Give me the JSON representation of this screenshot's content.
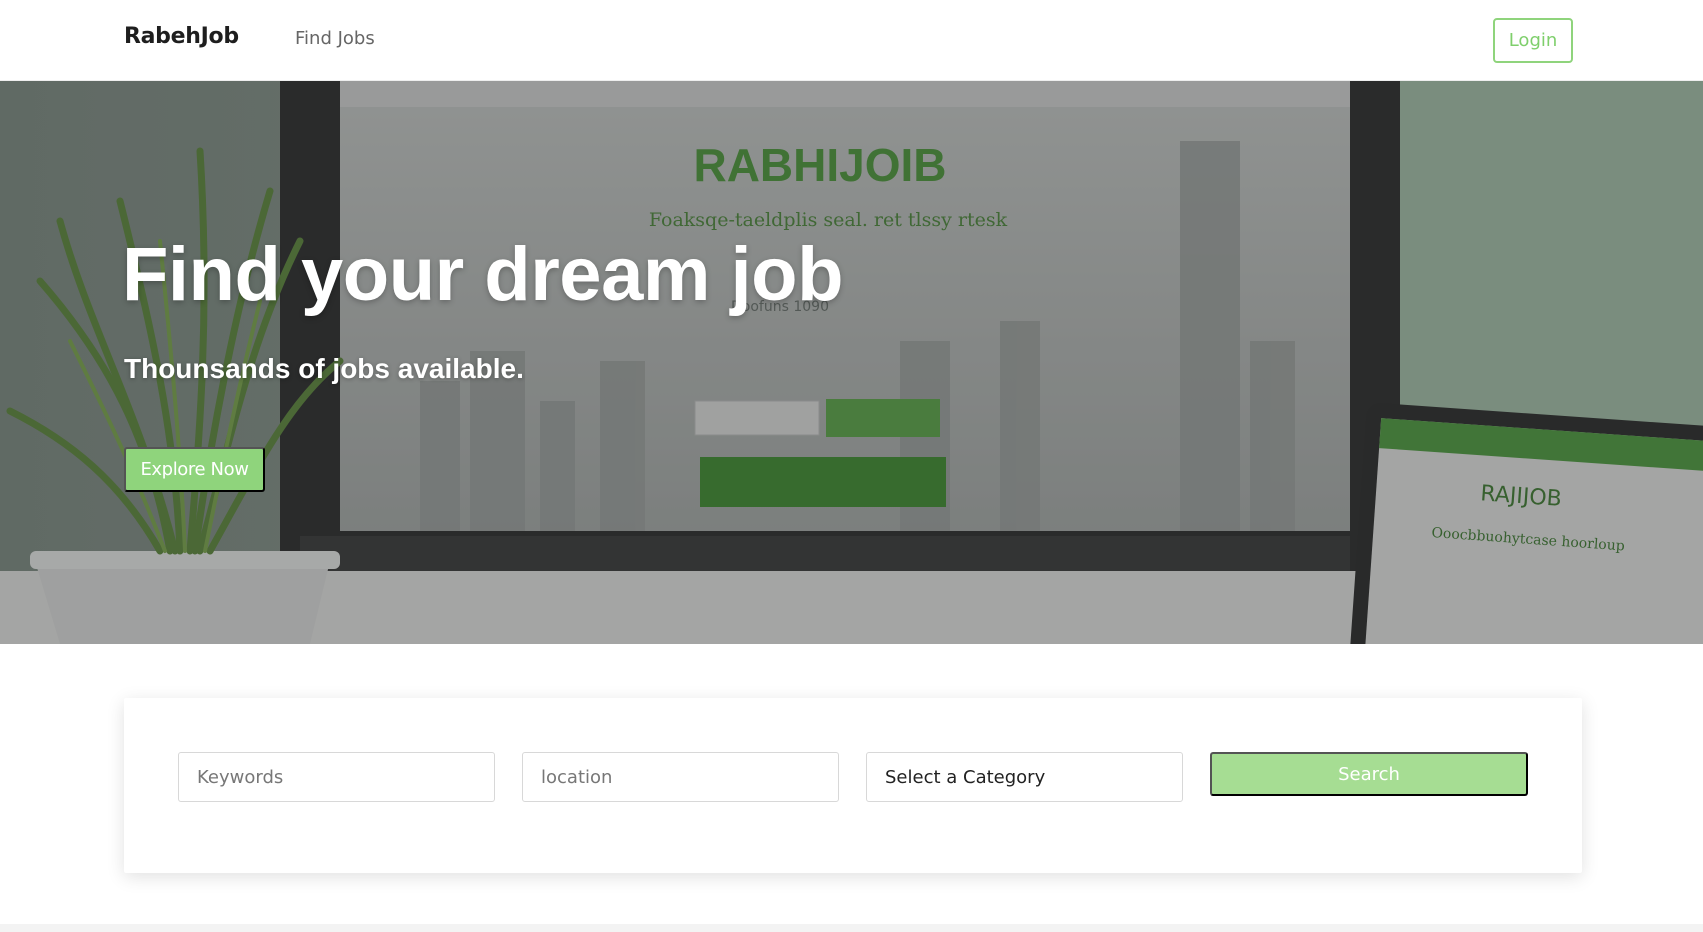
{
  "navbar": {
    "brand": "RabehJob",
    "links": [
      {
        "label": "Find Jobs"
      }
    ],
    "login_label": "Login"
  },
  "hero": {
    "title": "Find your dream job",
    "subtitle": "Thounsands of jobs available.",
    "cta_label": "Explore Now",
    "background_image": {
      "monitor_logo": "RABHIJOIB",
      "monitor_tagline": "Foaksqe-taeldplis seal. ret tlssy rtesk",
      "monitor_line": "Doofuns  1090",
      "tablet_logo": "RAJIJOB",
      "tablet_tagline": "Ooocbbuohytcase hoorloup"
    }
  },
  "search": {
    "keywords_placeholder": "Keywords",
    "location_placeholder": "location",
    "category_selected": "Select a Category",
    "button_label": "Search"
  },
  "colors": {
    "accent": "#8fd47c",
    "search_button": "#a6dd93",
    "brand_text": "#1e1e1e"
  }
}
